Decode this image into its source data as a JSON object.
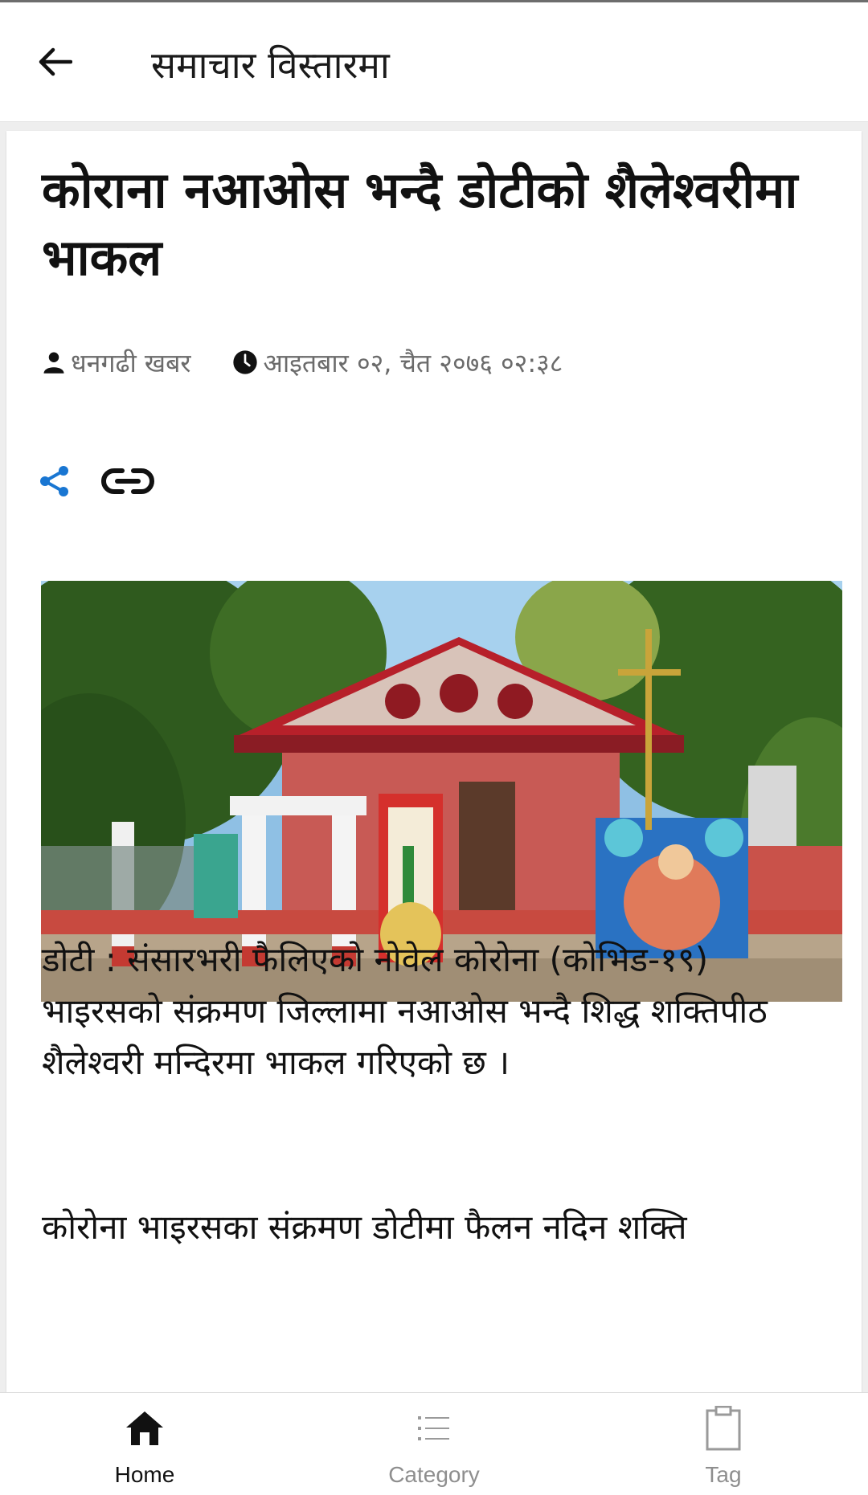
{
  "app_bar": {
    "title": "समाचार विस्तारमा",
    "back_icon": "arrow-left-icon"
  },
  "article": {
    "headline": "कोराना नआओस भन्दै डोटीको शैलेश्वरीमा भाकल",
    "author": "धनगढी खबर",
    "datetime": "आइतबार ०२, चैत २०७६ ०२:३८",
    "actions": [
      {
        "name": "share",
        "icon": "share-icon",
        "color": "#1976d2"
      },
      {
        "name": "link",
        "icon": "link-icon",
        "color": "#111111"
      }
    ],
    "image_alt": "Shaileshwari temple, Doti",
    "paragraphs": [
      "डोटी : संसारभरी फैलिएको नोवेल कोरोना (कोभिड-१९) भाइरसको संक्रमण जिल्लामा नआओस भन्दै शिद्ध शक्तिपीठ शैलेश्वरी मन्दिरमा भाकल गरिएको छ ।",
      "कोरोना भाइरसका संक्रमण डोटीमा फैलन नदिन शक्ति"
    ]
  },
  "bottom_nav": {
    "items": [
      {
        "label": "Home",
        "icon": "home-icon",
        "active": true
      },
      {
        "label": "Category",
        "icon": "list-icon",
        "active": false
      },
      {
        "label": "Tag",
        "icon": "clipboard-icon",
        "active": false
      }
    ],
    "active_color": "#111111",
    "inactive_color": "#8e8e8e"
  }
}
